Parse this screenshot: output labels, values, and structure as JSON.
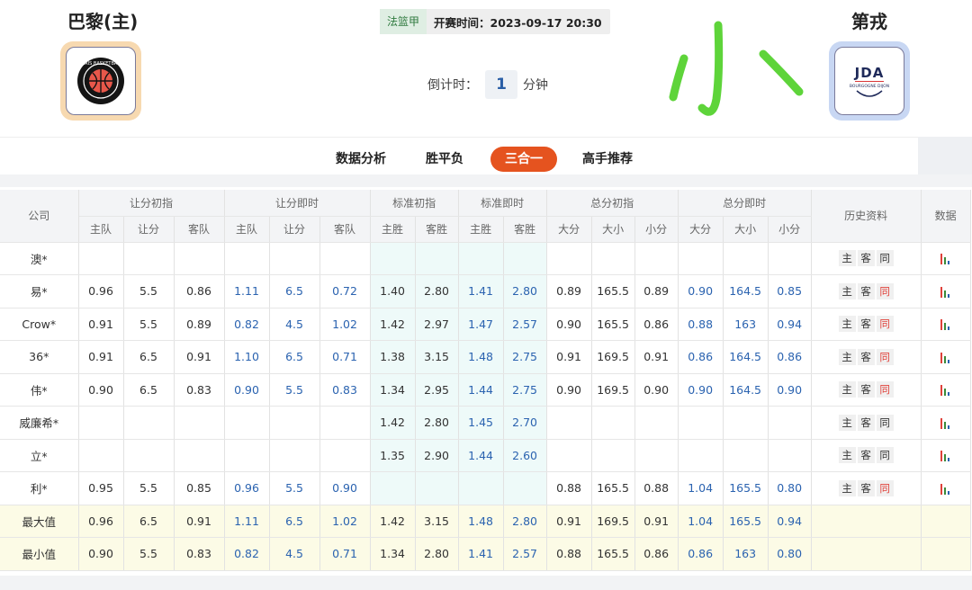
{
  "header": {
    "home_team": "巴黎(主)",
    "away_team": "第戎",
    "league": "法篮甲",
    "kickoff_label": "开赛时间：2023-09-17 20:30",
    "countdown_label": "倒计时：",
    "countdown_value": "1",
    "countdown_unit": "分钟",
    "home_logo_text": "PARIS BASKETBALL",
    "away_logo_text": "JDA",
    "away_logo_sub": "BOURGOGNE DIJON",
    "handwritten_note": "小"
  },
  "tabs": [
    {
      "label": "数据分析",
      "active": false
    },
    {
      "label": "胜平负",
      "active": false
    },
    {
      "label": "三合一",
      "active": true
    },
    {
      "label": "高手推荐",
      "active": false
    }
  ],
  "table": {
    "company_header": "公司",
    "group_headers": [
      "让分初指",
      "让分即时",
      "标准初指",
      "标准即时",
      "总分初指",
      "总分即时"
    ],
    "history_header": "历史资料",
    "data_header": "数据",
    "sub_headers": [
      "主队",
      "让分",
      "客队",
      "主队",
      "让分",
      "客队",
      "主胜",
      "客胜",
      "主胜",
      "客胜",
      "大分",
      "大小",
      "小分",
      "大分",
      "大小",
      "小分"
    ],
    "history_buttons": [
      "主",
      "客",
      "同"
    ],
    "rows": [
      {
        "company": "澳*",
        "cells": [
          "",
          "",
          "",
          "",
          "",
          "",
          "",
          "",
          "",
          "",
          "",
          "",
          "",
          "",
          "",
          ""
        ],
        "same_red": false
      },
      {
        "company": "易*",
        "cells": [
          "0.96",
          "5.5",
          "0.86",
          "1.11",
          "6.5",
          "0.72",
          "1.40",
          "2.80",
          "1.41",
          "2.80",
          "0.89",
          "165.5",
          "0.89",
          "0.90",
          "164.5",
          "0.85"
        ],
        "same_red": true
      },
      {
        "company": "Crow*",
        "cells": [
          "0.91",
          "5.5",
          "0.89",
          "0.82",
          "4.5",
          "1.02",
          "1.42",
          "2.97",
          "1.47",
          "2.57",
          "0.90",
          "165.5",
          "0.86",
          "0.88",
          "163",
          "0.94"
        ],
        "same_red": true
      },
      {
        "company": "36*",
        "cells": [
          "0.91",
          "6.5",
          "0.91",
          "1.10",
          "6.5",
          "0.71",
          "1.38",
          "3.15",
          "1.48",
          "2.75",
          "0.91",
          "169.5",
          "0.91",
          "0.86",
          "164.5",
          "0.86"
        ],
        "same_red": true
      },
      {
        "company": "伟*",
        "cells": [
          "0.90",
          "6.5",
          "0.83",
          "0.90",
          "5.5",
          "0.83",
          "1.34",
          "2.95",
          "1.44",
          "2.75",
          "0.90",
          "169.5",
          "0.90",
          "0.90",
          "164.5",
          "0.90"
        ],
        "same_red": true
      },
      {
        "company": "威廉希*",
        "cells": [
          "",
          "",
          "",
          "",
          "",
          "",
          "1.42",
          "2.80",
          "1.45",
          "2.70",
          "",
          "",
          "",
          "",
          "",
          ""
        ],
        "same_red": false
      },
      {
        "company": "立*",
        "cells": [
          "",
          "",
          "",
          "",
          "",
          "",
          "1.35",
          "2.90",
          "1.44",
          "2.60",
          "",
          "",
          "",
          "",
          "",
          ""
        ],
        "same_red": false
      },
      {
        "company": "利*",
        "cells": [
          "0.95",
          "5.5",
          "0.85",
          "0.96",
          "5.5",
          "0.90",
          "",
          "",
          "",
          "",
          "0.88",
          "165.5",
          "0.88",
          "1.04",
          "165.5",
          "0.80"
        ],
        "same_red": true
      }
    ],
    "summary": [
      {
        "label": "最大值",
        "cells": [
          "0.96",
          "6.5",
          "0.91",
          "1.11",
          "6.5",
          "1.02",
          "1.42",
          "3.15",
          "1.48",
          "2.80",
          "0.91",
          "169.5",
          "0.91",
          "1.04",
          "165.5",
          "0.94"
        ]
      },
      {
        "label": "最小值",
        "cells": [
          "0.90",
          "5.5",
          "0.83",
          "0.82",
          "4.5",
          "0.71",
          "1.34",
          "2.80",
          "1.41",
          "2.57",
          "0.88",
          "165.5",
          "0.86",
          "0.86",
          "163",
          "0.80"
        ]
      }
    ]
  },
  "colors": {
    "accent": "#e5531f",
    "live_odds": "#2b63b0",
    "handwriting": "#5ed43a",
    "same_red": "#e0413a",
    "league_green": "#2f7a3f"
  }
}
